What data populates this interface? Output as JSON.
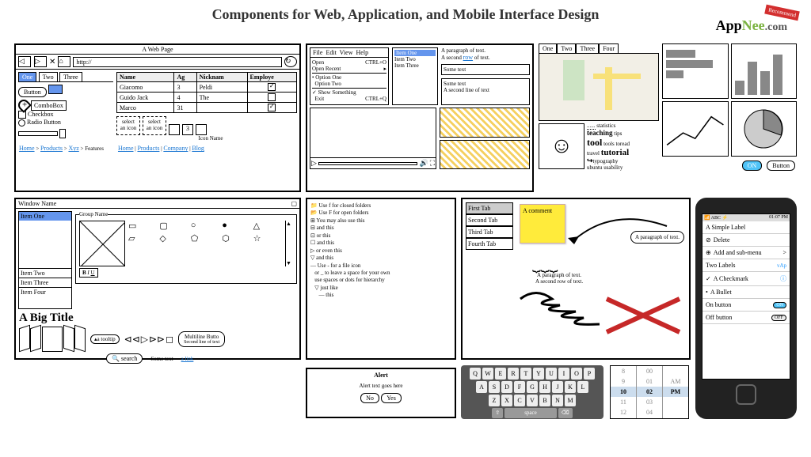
{
  "page_title": "Components for Web, Application, and Mobile Interface Design",
  "logo": {
    "part1": "App",
    "part2": "Nee",
    "part3": ".com",
    "badge": "Recommend"
  },
  "browser": {
    "title": "A Web Page",
    "url": "http://",
    "tabs": [
      "One",
      "Two",
      "Three"
    ],
    "button_label": "Button",
    "combo_label": "ComboBox",
    "checkbox_label": "Checkbox",
    "radio_label": "Radio Button",
    "icon_box1": "select an icon",
    "icon_box2": "select an icon",
    "icon_name": "Icon Name",
    "breadcrumb": [
      "Home",
      "Products",
      "Xyz",
      "Features"
    ],
    "footer_links": [
      "Home",
      "Products",
      "Company",
      "Blog"
    ],
    "table": {
      "headers": [
        "Name",
        "Ag",
        "Nicknam",
        "Employe"
      ],
      "rows": [
        [
          "Giacomo",
          "3",
          "Peldi",
          "☑"
        ],
        [
          "Guido Jack",
          "4",
          "The",
          ""
        ],
        [
          "Marco",
          "31",
          "",
          "☑"
        ]
      ]
    }
  },
  "menus": {
    "menubar": [
      "File",
      "Edit",
      "View",
      "Help"
    ],
    "file_items": [
      [
        "Open",
        "CTRL+O"
      ],
      [
        "Open Recent",
        ">"
      ],
      [
        "Option One",
        ""
      ],
      [
        "Option Two",
        ""
      ],
      [
        "Show Something",
        ""
      ],
      [
        "Exit",
        "CTRL+Q"
      ]
    ],
    "list": [
      "Item One",
      "Item Two",
      "Item Three"
    ],
    "para1": "A paragraph of text.",
    "para2_a": "A second ",
    "para2_link": "row",
    "para2_b": " of text.",
    "field1": "Some text",
    "field2a": "Some text",
    "field2b": "A second line of text"
  },
  "map_panel": {
    "tabs": [
      "One",
      "Two",
      "Three",
      "Four"
    ],
    "tagcloud": [
      "statistics",
      "teaching",
      "tips",
      "tool",
      "toread",
      "tools",
      "travel",
      "tutorial",
      "typography",
      "ubuntu",
      "usability"
    ],
    "toggle": "ON",
    "button": "Button"
  },
  "window": {
    "name": "Window Name",
    "list": [
      "Item One",
      "Item Two",
      "Item Three",
      "Item Four"
    ],
    "group": "Group Name",
    "big_title": "A Big Title",
    "tooltip": "a tooltip",
    "multiline_l1": "Multiline Butto",
    "multiline_l2": "Second line of text",
    "search": "search",
    "sometext": "Some text",
    "alink": "a link",
    "format_label": "B I U"
  },
  "tree": {
    "items": [
      "Use f for closed folders",
      "Use F for open folders",
      "You may also use this",
      "and this",
      "or this",
      "and this",
      "or even this",
      "and this",
      "Use - for a file icon",
      "or _ to leave a space for your own",
      "use spaces or dots for hierarchy",
      "just like",
      "this"
    ]
  },
  "tabs_vert": [
    "First Tab",
    "Second Tab",
    "Third Tab",
    "Fourth Tab"
  ],
  "annot": {
    "comment": "A comment",
    "callout": "A paragraph of text.",
    "brace1": "A paragraph of text.",
    "brace2": "A second row of text."
  },
  "alert": {
    "title": "Alert",
    "text": "Alert text goes here",
    "no": "No",
    "yes": "Yes"
  },
  "keyboard": {
    "r1": [
      "Q",
      "W",
      "E",
      "R",
      "T",
      "Y",
      "U",
      "I",
      "O",
      "P"
    ],
    "r2": [
      "A",
      "S",
      "D",
      "F",
      "G",
      "H",
      "J",
      "K",
      "L"
    ],
    "r3": [
      "Z",
      "X",
      "C",
      "V",
      "B",
      "N",
      "M"
    ]
  },
  "picker": {
    "col1": [
      "8",
      "9",
      "10",
      "11",
      "12"
    ],
    "col2": [
      "00",
      "01",
      "02",
      "03",
      "04"
    ],
    "col3": [
      "AM",
      "PM"
    ]
  },
  "phone": {
    "carrier": "ABC",
    "time": "01:07 PM",
    "rows": [
      {
        "l": "A Simple Label"
      },
      {
        "l": "Delete",
        "ico": "⊘"
      },
      {
        "l": "Add and sub-menu",
        "ico": "⊕",
        "arr": ">"
      },
      {
        "l": "Two Labels",
        "r": "vAp"
      },
      {
        "l": "A Checkmark",
        "ico": "✓",
        "info": "ⓘ"
      },
      {
        "l": "A Bullet",
        "ico": "•"
      },
      {
        "l": "On button",
        "toggle": "ON"
      },
      {
        "l": "Off button",
        "toggle": "OFF"
      }
    ]
  }
}
